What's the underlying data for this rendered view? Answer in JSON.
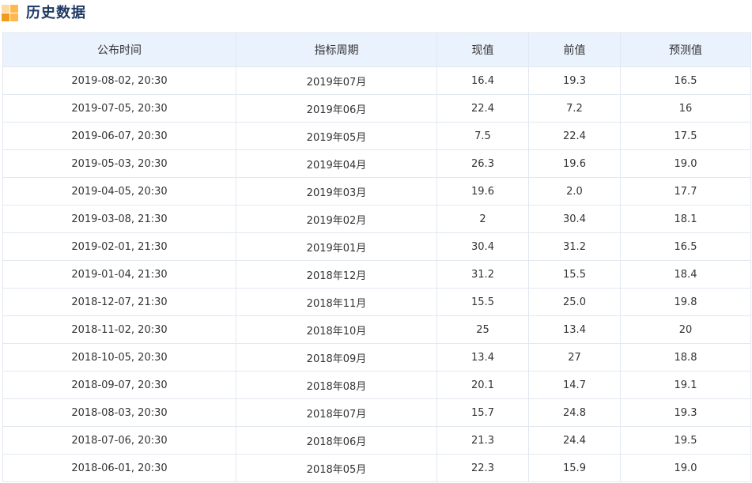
{
  "header": {
    "title": "历史数据",
    "icon": "history-data-icon",
    "icon_colors": [
      "#ffb84d",
      "#f39a1e",
      "#ffd9a3"
    ]
  },
  "table": {
    "columns": [
      "公布时间",
      "指标周期",
      "现值",
      "前值",
      "预测值"
    ],
    "rows": [
      [
        "2019-08-02, 20:30",
        "2019年07月",
        "16.4",
        "19.3",
        "16.5"
      ],
      [
        "2019-07-05, 20:30",
        "2019年06月",
        "22.4",
        "7.2",
        "16"
      ],
      [
        "2019-06-07, 20:30",
        "2019年05月",
        "7.5",
        "22.4",
        "17.5"
      ],
      [
        "2019-05-03, 20:30",
        "2019年04月",
        "26.3",
        "19.6",
        "19.0"
      ],
      [
        "2019-04-05, 20:30",
        "2019年03月",
        "19.6",
        "2.0",
        "17.7"
      ],
      [
        "2019-03-08, 21:30",
        "2019年02月",
        "2",
        "30.4",
        "18.1"
      ],
      [
        "2019-02-01, 21:30",
        "2019年01月",
        "30.4",
        "31.2",
        "16.5"
      ],
      [
        "2019-01-04, 21:30",
        "2018年12月",
        "31.2",
        "15.5",
        "18.4"
      ],
      [
        "2018-12-07, 21:30",
        "2018年11月",
        "15.5",
        "25.0",
        "19.8"
      ],
      [
        "2018-11-02, 20:30",
        "2018年10月",
        "25",
        "13.4",
        "20"
      ],
      [
        "2018-10-05, 20:30",
        "2018年09月",
        "13.4",
        "27",
        "18.8"
      ],
      [
        "2018-09-07, 20:30",
        "2018年08月",
        "20.1",
        "14.7",
        "19.1"
      ],
      [
        "2018-08-03, 20:30",
        "2018年07月",
        "15.7",
        "24.8",
        "19.3"
      ],
      [
        "2018-07-06, 20:30",
        "2018年06月",
        "21.3",
        "24.4",
        "19.5"
      ],
      [
        "2018-06-01, 20:30",
        "2018年05月",
        "22.3",
        "15.9",
        "19.0"
      ]
    ]
  },
  "colors": {
    "header_bg": "#eaf2fd",
    "border": "#e2e8f0",
    "title": "#1f3a63"
  }
}
